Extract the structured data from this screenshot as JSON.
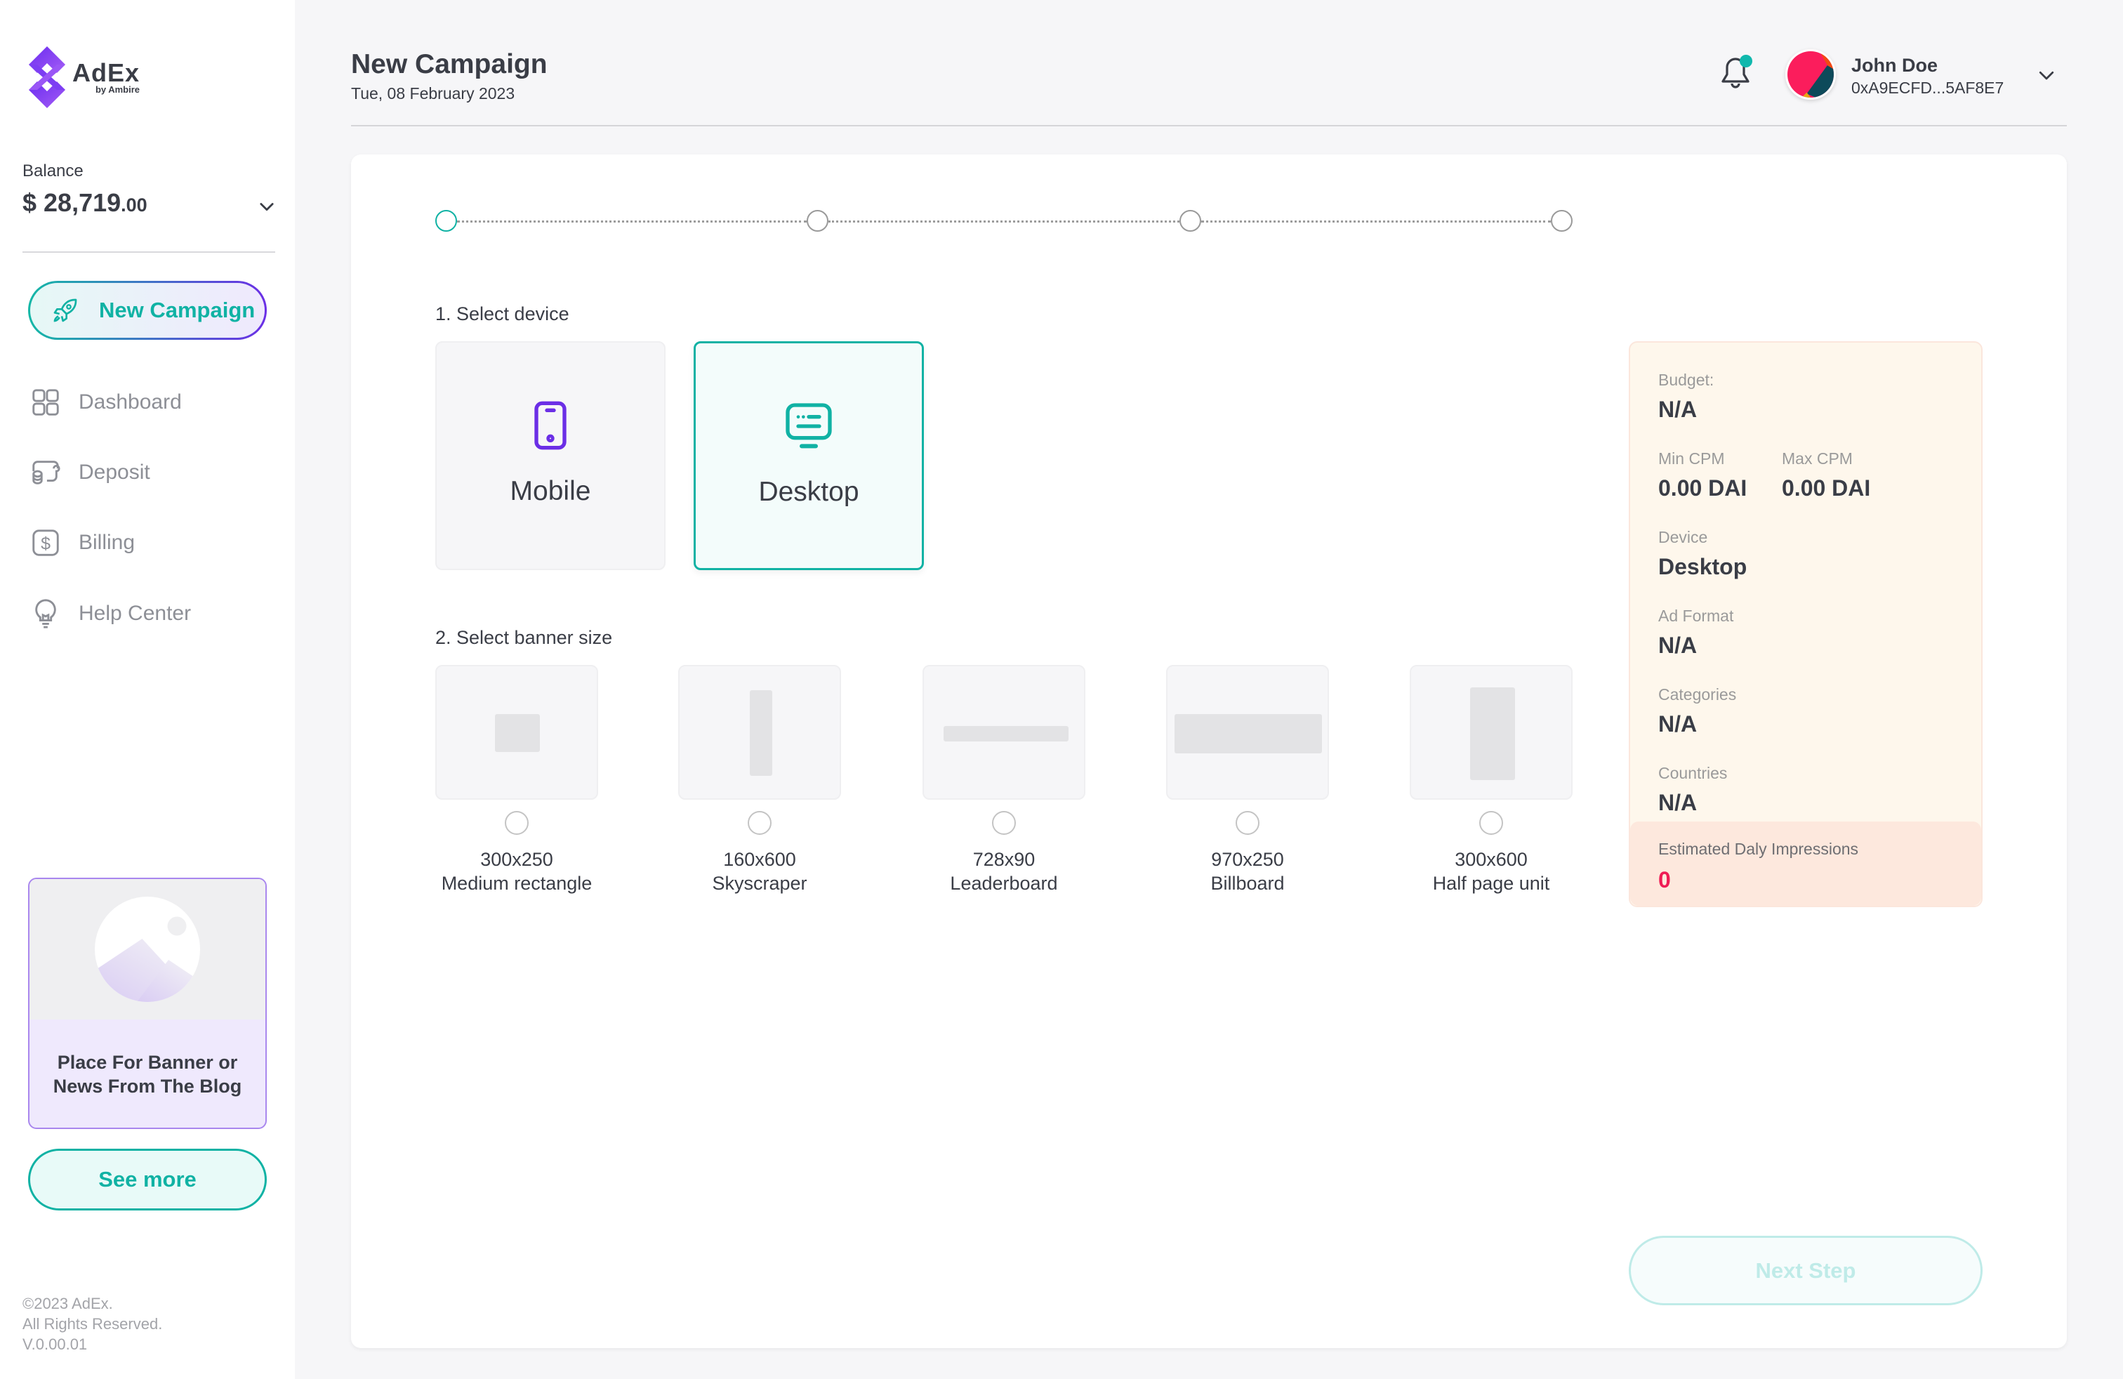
{
  "brand": {
    "name": "AdEx",
    "subtitle": "by Ambire",
    "primary_color": "#10b2a4",
    "secondary_color": "#6b2ee6"
  },
  "sidebar": {
    "balance_label": "Balance",
    "balance_main": "$ 28,719",
    "balance_cents": ".00",
    "new_campaign_label": "New Campaign",
    "nav_items": [
      {
        "label": "Dashboard",
        "icon": "grid-icon"
      },
      {
        "label": "Deposit",
        "icon": "deposit-coins-icon"
      },
      {
        "label": "Billing",
        "icon": "dollar-icon"
      },
      {
        "label": "Help Center",
        "icon": "lightbulb-icon"
      }
    ],
    "promo_text": "Place For Banner or News From The Blog",
    "see_more_label": "See more",
    "footer": {
      "copyright": "©2023 AdEx.",
      "rights": "All Rights Reserved.",
      "version": "V.0.00.01"
    }
  },
  "header": {
    "title": "New Campaign",
    "date": "Tue, 08 February 2023",
    "notifications_unread": true,
    "user": {
      "name": "John Doe",
      "address": "0xA9ECFD...5AF8E7"
    }
  },
  "wizard": {
    "steps": [
      {
        "state": "active"
      },
      {
        "state": "pending"
      },
      {
        "state": "pending"
      },
      {
        "state": "pending"
      }
    ],
    "device_section_label": "1. Select device",
    "devices": [
      {
        "label": "Mobile",
        "icon": "mobile-icon",
        "selected": false
      },
      {
        "label": "Desktop",
        "icon": "desktop-icon",
        "selected": true
      }
    ],
    "banner_section_label": "2. Select banner size",
    "banners": [
      {
        "size": "300x250",
        "name": "Medium rectangle",
        "selected": false
      },
      {
        "size": "160x600",
        "name": "Skyscraper",
        "selected": false
      },
      {
        "size": "728x90",
        "name": "Leaderboard",
        "selected": false
      },
      {
        "size": "970x250",
        "name": "Billboard",
        "selected": false
      },
      {
        "size": "300x600",
        "name": "Half page unit",
        "selected": false
      }
    ],
    "next_step_label": "Next Step",
    "next_step_enabled": false
  },
  "summary": {
    "budget": {
      "label": "Budget:",
      "value": "N/A"
    },
    "min_cpm": {
      "label": "Min CPM",
      "value": "0.00 DAI"
    },
    "max_cpm": {
      "label": "Max CPM",
      "value": "0.00 DAI"
    },
    "device": {
      "label": "Device",
      "value": "Desktop"
    },
    "ad_format": {
      "label": "Ad Format",
      "value": "N/A"
    },
    "categories": {
      "label": "Categories",
      "value": "N/A"
    },
    "countries": {
      "label": "Countries",
      "value": "N/A"
    },
    "impressions": {
      "label": "Estimated Daly Impressions",
      "value": "0"
    }
  }
}
